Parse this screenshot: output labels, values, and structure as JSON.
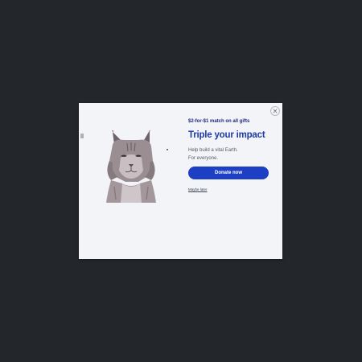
{
  "modal": {
    "eyebrow": "$2-for-$1 match on all gifts",
    "headline": "Triple your impact",
    "subtext_line1": "Help build a vital Earth.",
    "subtext_line2": "For everyone.",
    "donate_label": "Donate now",
    "link_label": "Maybe later",
    "close_icon": "close-icon",
    "image": "lynx-illustration"
  },
  "colors": {
    "backdrop": "#23272b",
    "modal_bg": "#f3f4f8",
    "headline": "#1d3aa8",
    "eyebrow": "#1f2a7a",
    "button": "#1c3fc4"
  }
}
